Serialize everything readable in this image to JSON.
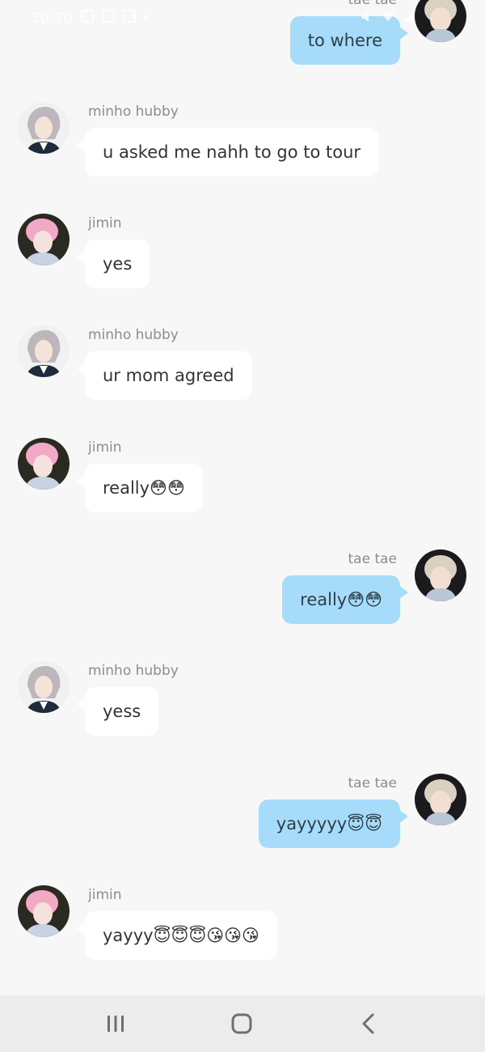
{
  "status_bar": {
    "time": "20:20",
    "icons_left": [
      "gallery-icon",
      "document-icon",
      "message-icon",
      "dot-icon"
    ],
    "icons_right": [
      "mute-icon",
      "wifi-icon",
      "signal-icon"
    ]
  },
  "participants": {
    "tae": {
      "name": "tae tae",
      "avatar": "tae-avatar"
    },
    "minho": {
      "name": "minho hubby",
      "avatar": "minho-avatar"
    },
    "jimin": {
      "name": "jimin",
      "avatar": "jimin-avatar"
    }
  },
  "messages": [
    {
      "sender": "tae tae",
      "side": "right",
      "text": "to where"
    },
    {
      "sender": "minho hubby",
      "side": "left",
      "text": "u asked me nahh to go to tour"
    },
    {
      "sender": "jimin",
      "side": "left",
      "text": "yes"
    },
    {
      "sender": "minho hubby",
      "side": "left",
      "text": "ur mom agreed"
    },
    {
      "sender": "jimin",
      "side": "left",
      "text": "really😳😳"
    },
    {
      "sender": "tae tae",
      "side": "right",
      "text": "really😳😳"
    },
    {
      "sender": "minho hubby",
      "side": "left",
      "text": "yess"
    },
    {
      "sender": "tae tae",
      "side": "right",
      "text": "yayyyyy😇😇"
    },
    {
      "sender": "jimin",
      "side": "left",
      "text": "yayyy😇😇😇😘😘😘"
    }
  ],
  "colors": {
    "background": "#f7f7f7",
    "outgoing_bubble": "#a6dcf9",
    "incoming_bubble": "#ffffff",
    "sender_name": "#8c8c8c",
    "nav_bar": "#ececec"
  },
  "nav": {
    "recent_icon": "recent-apps-icon",
    "home_icon": "home-icon",
    "back_icon": "back-icon"
  }
}
